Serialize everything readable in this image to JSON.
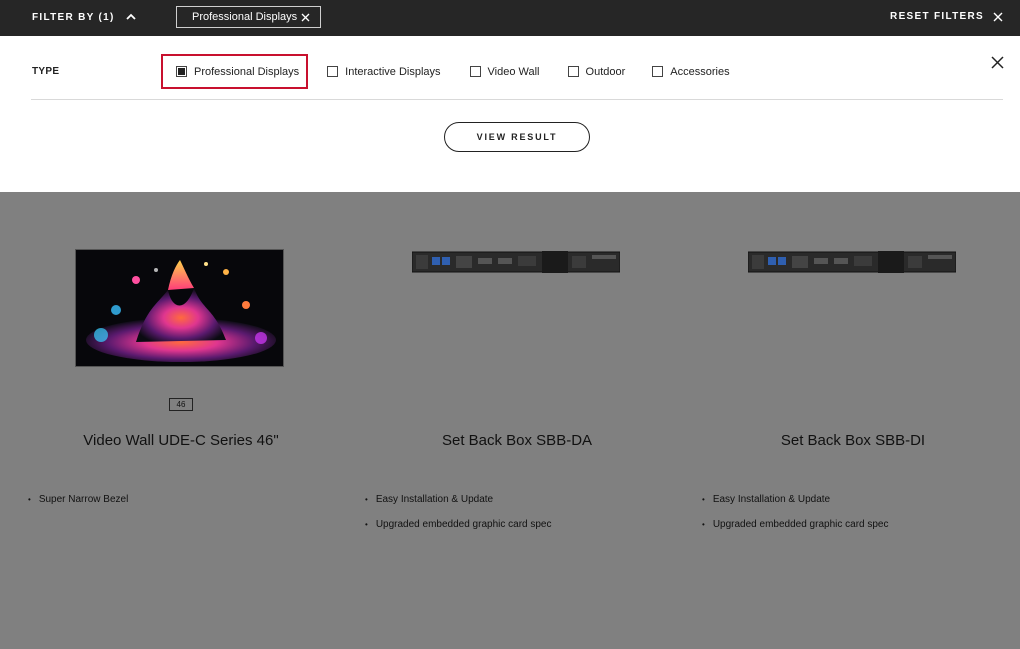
{
  "topbar": {
    "filter_by": "FILTER BY (1)",
    "chip_label": "Professional Displays",
    "reset": "RESET FILTERS"
  },
  "panel": {
    "type_label": "TYPE",
    "options": [
      {
        "label": "Professional Displays",
        "checked": true
      },
      {
        "label": "Interactive Displays",
        "checked": false
      },
      {
        "label": "Video Wall",
        "checked": false
      },
      {
        "label": "Outdoor",
        "checked": false
      },
      {
        "label": "Accessories",
        "checked": false
      }
    ],
    "view_result": "VIEW RESULT"
  },
  "products": [
    {
      "size_badge": "46",
      "title": "Video Wall UDE-C Series 46\"",
      "features": [
        "Super Narrow Bezel"
      ]
    },
    {
      "title": "Set Back Box SBB-DA",
      "features": [
        "Easy Installation & Update",
        "Upgraded embedded graphic card spec"
      ]
    },
    {
      "title": "Set Back Box SBB-DI",
      "features": [
        "Easy Installation & Update",
        "Upgraded embedded graphic card spec"
      ]
    }
  ],
  "colors": {
    "topbar_bg": "#262626",
    "overlay_bg": "#808080",
    "highlight": "#c8102e"
  }
}
